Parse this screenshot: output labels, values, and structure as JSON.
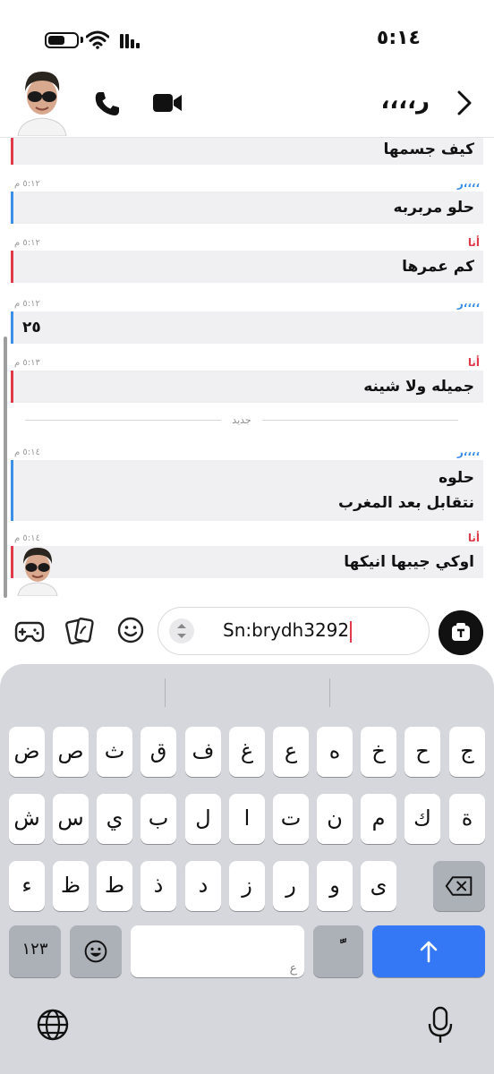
{
  "status_bar": {
    "time": "٥:١٤"
  },
  "header": {
    "title": "ر،،،،",
    "icons": {
      "call": "phone-icon",
      "video": "video-icon",
      "back": "chevron-right-icon"
    }
  },
  "messages": [
    {
      "sender": "",
      "time": "",
      "text": [
        "كيف جسمها"
      ],
      "from": "me"
    },
    {
      "sender": "ر،،،،",
      "time": "٥:١٢ م",
      "text": [
        "حلو مربربه"
      ],
      "from": "them"
    },
    {
      "sender": "أنا",
      "time": "٥:١٢ م",
      "text": [
        "كم عمرها"
      ],
      "from": "me"
    },
    {
      "sender": "ر،،،،",
      "time": "٥:١٢ م",
      "text": [
        "٢٥"
      ],
      "from": "them"
    },
    {
      "sender": "أنا",
      "time": "٥:١٣ م",
      "text": [
        "جميله ولا شينه"
      ],
      "from": "me"
    },
    {
      "sender": "ر،،،،",
      "time": "٥:١٤ م",
      "text": [
        "حلوه",
        "نتقابل بعد المغرب"
      ],
      "from": "them"
    },
    {
      "sender": "أنا",
      "time": "٥:١٤ م",
      "text": [
        "اوكي جيبها انيكها"
      ],
      "from": "me"
    }
  ],
  "divider_label": "جديد",
  "composer": {
    "value": "Sn:brydh3292"
  },
  "keyboard": {
    "row1": [
      "ض",
      "ص",
      "ث",
      "ق",
      "ف",
      "غ",
      "ع",
      "ه",
      "خ",
      "ح",
      "ج"
    ],
    "row2": [
      "ش",
      "س",
      "ي",
      "ب",
      "ل",
      "ا",
      "ت",
      "ن",
      "م",
      "ك",
      "ة"
    ],
    "row3": [
      "ء",
      "ظ",
      "ط",
      "ذ",
      "د",
      "ز",
      "ر",
      "و",
      "ى"
    ],
    "numbers_key": "١٢٣",
    "space_hint": "ع",
    "diacritic_key": "ًّ",
    "colors": {
      "send": "#3478f6",
      "me": "#e03a4a",
      "them": "#3a8fe8"
    }
  }
}
